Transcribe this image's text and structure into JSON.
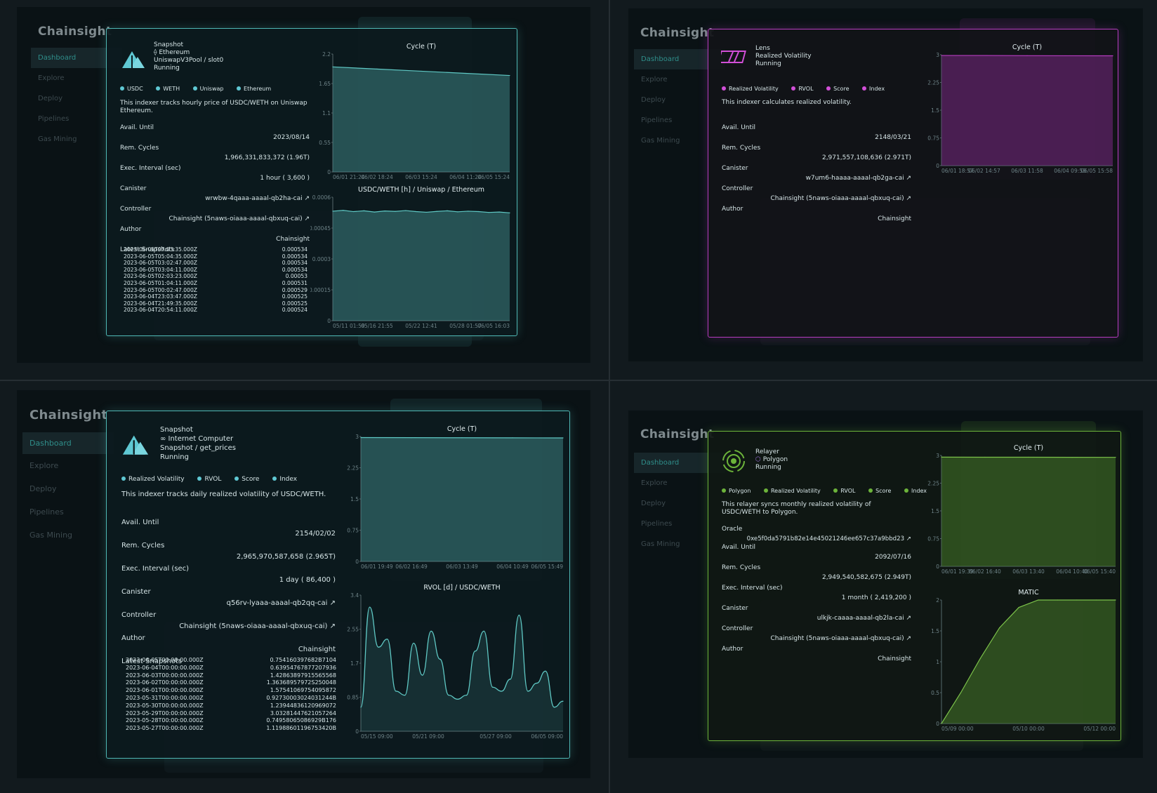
{
  "brand": "Chainsight",
  "nav": [
    "Dashboard",
    "Explore",
    "Deploy",
    "Pipelines",
    "Gas Mining"
  ],
  "colors": {
    "teal": "#4fb7b4",
    "pink": "#b63cc0",
    "green": "#6cb33a"
  },
  "panels": [
    {
      "kind": "Snapshot",
      "chain": "Ethereum",
      "chain_icon": "ethereum-icon",
      "source": "UniswapV3Pool / slot0",
      "status": "Running",
      "tags": [
        "USDC",
        "WETH",
        "Uniswap",
        "Ethereum"
      ],
      "description": "This indexer tracks hourly price of USDC/WETH on Uniswap Ethereum.",
      "avail_label": "Avail. Until",
      "avail": "2023/08/14",
      "cycles_label": "Rem. Cycles",
      "cycles": "1,966,331,833,372 (1.96T)",
      "exec_label": "Exec. Interval (sec)",
      "exec": "1 hour ( 3,600 )",
      "canister_label": "Canister",
      "canister": "wrwbw-4qaaa-aaaal-qb2ha-cai ↗",
      "controller_label": "Controller",
      "controller": "Chainsight (5naws-oiaaa-aaaal-qbxuq-cai) ↗",
      "author_label": "Author",
      "author": "Chainsight",
      "snapshots_label": "Latest Snapshots",
      "snapshots": [
        [
          "2023-06-05T07:03:35.000Z",
          "0.000534"
        ],
        [
          "2023-06-05T05:04:35.000Z",
          "0.000534"
        ],
        [
          "2023-06-05T03:02:47.000Z",
          "0.000534"
        ],
        [
          "2023-06-05T03:04:11.000Z",
          "0.000534"
        ],
        [
          "2023-06-05T02:03:23.000Z",
          "0.00053"
        ],
        [
          "2023-06-05T01:04:11.000Z",
          "0.000531"
        ],
        [
          "2023-06-05T00:02:47.000Z",
          "0.000529"
        ],
        [
          "2023-06-04T23:03:47.000Z",
          "0.000525"
        ],
        [
          "2023-06-04T21:49:35.000Z",
          "0.000525"
        ],
        [
          "2023-06-04T20:54:11.000Z",
          "0.000524"
        ]
      ]
    },
    {
      "kind": "Lens",
      "name": "Realized Volatility",
      "status": "Running",
      "tags": [
        "Realized Volatility",
        "RVOL",
        "Score",
        "Index"
      ],
      "description": "This indexer calculates realized volatility.",
      "avail_label": "Avail. Until",
      "avail": "2148/03/21",
      "cycles_label": "Rem. Cycles",
      "cycles": "2,971,557,108,636 (2.971T)",
      "canister_label": "Canister",
      "canister": "w7um6-haaaa-aaaal-qb2ga-cai ↗",
      "controller_label": "Controller",
      "controller": "Chainsight (5naws-oiaaa-aaaal-qbxuq-cai) ↗",
      "author_label": "Author",
      "author": "Chainsight"
    },
    {
      "kind": "Snapshot",
      "chain": "Internet Computer",
      "chain_icon": "infinity-icon",
      "source": "Snapshot / get_prices",
      "status": "Running",
      "tags": [
        "Realized Volatility",
        "RVOL",
        "Score",
        "Index"
      ],
      "description": "This indexer tracks daily realized volatility of USDC/WETH.",
      "avail_label": "Avail. Until",
      "avail": "2154/02/02",
      "cycles_label": "Rem. Cycles",
      "cycles": "2,965,970,587,658 (2.965T)",
      "exec_label": "Exec. Interval (sec)",
      "exec": "1 day ( 86,400 )",
      "canister_label": "Canister",
      "canister": "q56rv-lyaaa-aaaal-qb2qq-cai ↗",
      "controller_label": "Controller",
      "controller": "Chainsight (5naws-oiaaa-aaaal-qbxuq-cai) ↗",
      "author_label": "Author",
      "author": "Chainsight",
      "snapshots_label": "Latest Snapshots",
      "snapshots": [
        [
          "2023-06-05T00:00:00.000Z",
          "0.754160397682B7104"
        ],
        [
          "2023-06-04T00:00:00.000Z",
          "0.63954767877207936"
        ],
        [
          "2023-06-03T00:00:00.000Z",
          "1.42863897915565568"
        ],
        [
          "2023-06-02T00:00:00.000Z",
          "1.36368957972S250048"
        ],
        [
          "2023-06-01T00:00:00.000Z",
          "1.57541069754095872"
        ],
        [
          "2023-05-31T00:00:00.000Z",
          "0.92730003024031244B"
        ],
        [
          "2023-05-30T00:00:00.000Z",
          "1.23944836120969072"
        ],
        [
          "2023-05-29T00:00:00.000Z",
          "3.03281447621057264"
        ],
        [
          "2023-05-28T00:00:00.000Z",
          "0.74958065086929B176"
        ],
        [
          "2023-05-27T00:00:00.000Z",
          "1.11988601196753420B"
        ]
      ]
    },
    {
      "kind": "Relayer",
      "chain": "Polygon",
      "chain_icon": "polygon-icon",
      "status": "Running",
      "tags": [
        "Polygon",
        "Realized Volatility",
        "RVOL",
        "Score",
        "Index"
      ],
      "description": "This relayer syncs monthly realized volatility of USDC/WETH to Polygon.",
      "oracle_label": "Oracle",
      "oracle": "0xe5f0da5791b82e14e45021246ee657c37a9bbd23 ↗",
      "avail_label": "Avail. Until",
      "avail": "2092/07/16",
      "cycles_label": "Rem. Cycles",
      "cycles": "2,949,540,582,675 (2.949T)",
      "exec_label": "Exec. Interval (sec)",
      "exec": "1 month ( 2,419,200 )",
      "canister_label": "Canister",
      "canister": "ulkjk-caaaa-aaaal-qb2la-cai ↗",
      "controller_label": "Controller",
      "controller": "Chainsight (5naws-oiaaa-aaaal-qbxuq-cai) ↗",
      "author_label": "Author",
      "author": "Chainsight"
    }
  ],
  "chart_data": [
    {
      "type": "area",
      "title": "Cycle (T)",
      "x": [
        "06/01 21:24",
        "06/02 18:24",
        "06/03 15:24",
        "06/04 11:24",
        "06/05 15:24"
      ],
      "y_ticks": [
        "0",
        "0.55",
        "1.1",
        "1.65",
        "2.2"
      ],
      "ylim": [
        0,
        2.2
      ],
      "values": [
        1.96,
        1.92,
        1.88,
        1.84,
        1.8
      ]
    },
    {
      "type": "area",
      "title": "USDC/WETH [h] / Uniswap / Ethereum",
      "x": [
        "05/11 01:59",
        "05/16 21:55",
        "05/22 12:41",
        "05/28 01:57",
        "06/05 16:03"
      ],
      "y_ticks": [
        "0",
        "0.00015",
        "0.0003",
        "0.00045",
        "0.0006"
      ],
      "ylim": [
        0,
        0.0006
      ],
      "values": [
        0.000532,
        0.000536,
        0.00053,
        0.000534,
        0.000528,
        0.000533,
        0.000531,
        0.000535,
        0.00053,
        0.000527,
        0.000531,
        0.000534,
        0.000529,
        0.000532,
        0.00053,
        0.000526,
        0.000528,
        0.000524
      ]
    },
    {
      "type": "area",
      "title": "Cycle (T)",
      "x": [
        "06/01 18:57",
        "06/02 14:57",
        "06/03 11:58",
        "06/04 09:58",
        "06/05 15:58"
      ],
      "y_ticks": [
        "0",
        "0.75",
        "1.5",
        "2.25",
        "3"
      ],
      "ylim": [
        0,
        3
      ],
      "values": [
        2.98,
        2.98,
        2.975,
        2.973,
        2.972
      ]
    },
    {
      "type": "area",
      "title": "Cycle (T)",
      "x": [
        "06/01 19:49",
        "06/02 16:49",
        "06/03 13:49",
        "06/04 10:49",
        "06/05 15:49"
      ],
      "y_ticks": [
        "0",
        "0.75",
        "1.5",
        "2.25",
        "3"
      ],
      "ylim": [
        0,
        3
      ],
      "values": [
        2.975,
        2.972,
        2.97,
        2.968,
        2.966
      ]
    },
    {
      "type": "line",
      "title": "RVOL [d] / USDC/WETH",
      "x": [
        "05/15 09:00",
        "05/21 09:00",
        "05/27 09:00",
        "06/05 09:00"
      ],
      "y_ticks": [
        "0",
        "0.85",
        "1.7",
        "2.55",
        "3.4"
      ],
      "ylim": [
        0,
        3.4
      ],
      "values": [
        0.6,
        3.1,
        2.1,
        2.3,
        1.0,
        0.9,
        2.2,
        1.4,
        2.5,
        1.8,
        0.9,
        0.8,
        0.9,
        2.0,
        2.5,
        1.1,
        1.0,
        1.3,
        2.9,
        1.0,
        1.2,
        1.5,
        0.6,
        0.75
      ]
    },
    {
      "type": "area",
      "title": "Cycle (T)",
      "x": [
        "06/01 19:39",
        "06/02 16:40",
        "06/03 13:40",
        "06/04 10:40",
        "06/05 15:40"
      ],
      "y_ticks": [
        "0",
        "0.75",
        "1.5",
        "2.25",
        "3"
      ],
      "ylim": [
        0,
        3
      ],
      "values": [
        2.955,
        2.953,
        2.952,
        2.95,
        2.949
      ]
    },
    {
      "type": "area",
      "title": "MATIC",
      "x": [
        "05/09 00:00",
        "05/10 00:00",
        "05/12 00:00"
      ],
      "y_ticks": [
        "0",
        "0.5",
        "1",
        "1.5",
        "2"
      ],
      "ylim": [
        0,
        2
      ],
      "values": [
        0,
        0.5,
        1.05,
        1.55,
        1.88,
        2,
        2,
        2,
        2,
        2
      ]
    }
  ]
}
